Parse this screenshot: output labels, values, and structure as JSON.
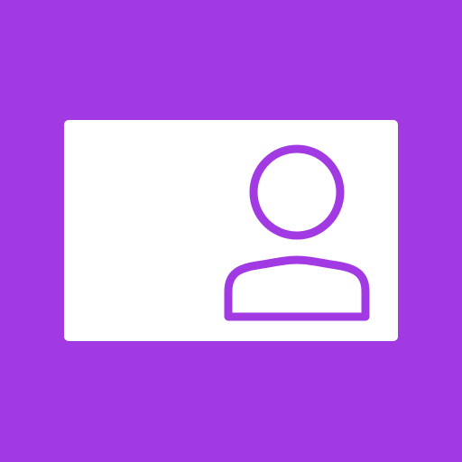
{
  "colors": {
    "background": "#a23ae4",
    "card": "#ffffff",
    "icon_stroke": "#a23ae4"
  },
  "icons": {
    "card": "id-card-icon",
    "avatar": "user-avatar-icon"
  }
}
